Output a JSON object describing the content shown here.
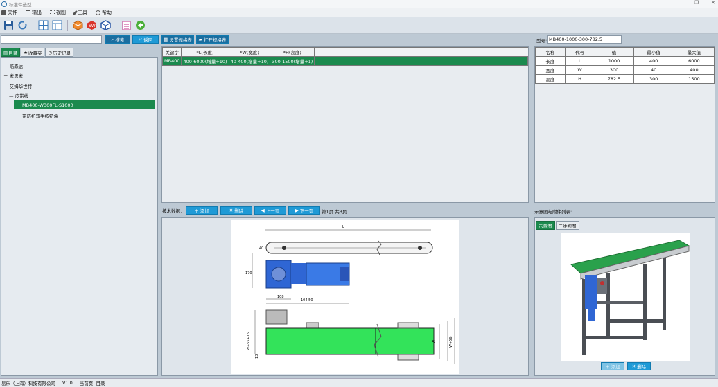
{
  "window": {
    "title": "标准件选型",
    "minimize": "—",
    "restore": "❐",
    "close": "✕"
  },
  "menu": [
    {
      "label": "文件",
      "icon": "file-icon"
    },
    {
      "label": "输出",
      "icon": "document-icon"
    },
    {
      "label": "视图",
      "icon": "view-icon"
    },
    {
      "label": "工具",
      "icon": "wrench-icon"
    },
    {
      "label": "帮助",
      "icon": "help-icon"
    }
  ],
  "left": {
    "search_value": "",
    "search_btn": "搜索",
    "back_btn": "返回",
    "tabs": [
      "目录",
      "收藏夹",
      "历史记录"
    ],
    "tree": {
      "n1": "皓森达",
      "n2": "米思米",
      "n3": "艾姆华世特",
      "n4": "皮带线",
      "n5": "MB400-W300FL-S1000",
      "n6": "带防护双手按钮盒"
    }
  },
  "mid": {
    "set_btn": "设置规格表",
    "open_btn": "打开规格表",
    "headers": [
      "关键字",
      "*L(长度)",
      "*W(宽度)",
      "*H(高度)"
    ],
    "row": [
      "MB400",
      "400-6000(增量+10)",
      "40-400(增量+10)",
      "300-1500(增量+1)"
    ],
    "tech_label": "技术数据：",
    "add_btn": "添加",
    "del_btn": "删除",
    "prev_btn": "上一页",
    "next_btn": "下一页",
    "page_info": "第1页 共3页"
  },
  "drawing": {
    "L": "L",
    "d40": "40",
    "d170": "170",
    "d108": "108",
    "d104": "104.50",
    "dW55": "W+55+15",
    "dW": "W",
    "dW56": "W+56",
    "d13": "13"
  },
  "right": {
    "model_label": "型号:",
    "model_value": "MB400-1000-300-782.5",
    "headers": [
      "名称",
      "代号",
      "值",
      "最小值",
      "最大值"
    ],
    "rows": [
      [
        "长度",
        "L",
        "1000",
        "400",
        "6000"
      ],
      [
        "宽度",
        "W",
        "300",
        "40",
        "400"
      ],
      [
        "高度",
        "H",
        "782.5",
        "300",
        "1500"
      ]
    ],
    "attach_label": "示意图与附件列表:",
    "tabs": [
      "示意图",
      "三维视图"
    ],
    "add_btn": "添加",
    "del_btn": "删除"
  },
  "status": {
    "company": "易乐（上海）科技有限公司",
    "version": "V1.0",
    "current": "当前页: 目录"
  }
}
